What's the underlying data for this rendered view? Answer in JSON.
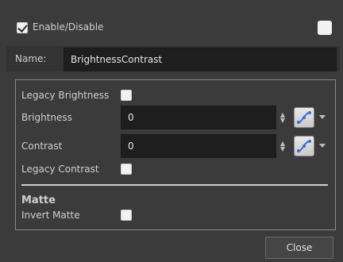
{
  "header": {
    "enable_label": "Enable/Disable",
    "enable_checked": true,
    "color_swatch": "#f2f2f2"
  },
  "name_row": {
    "label": "Name:",
    "value": "BrightnessContrast"
  },
  "params": {
    "legacy_brightness": {
      "label": "Legacy Brightness",
      "checked": false
    },
    "brightness": {
      "label": "Brightness",
      "value": "0"
    },
    "contrast": {
      "label": "Contrast",
      "value": "0"
    },
    "legacy_contrast": {
      "label": "Legacy Contrast",
      "checked": false
    }
  },
  "matte": {
    "section_title": "Matte",
    "invert_label": "Invert Matte",
    "invert_checked": false
  },
  "footer": {
    "close_label": "Close"
  },
  "colors": {
    "background": "#3b3b3b",
    "field_bg": "#1e1e1e",
    "border": "#8a8a8a"
  }
}
